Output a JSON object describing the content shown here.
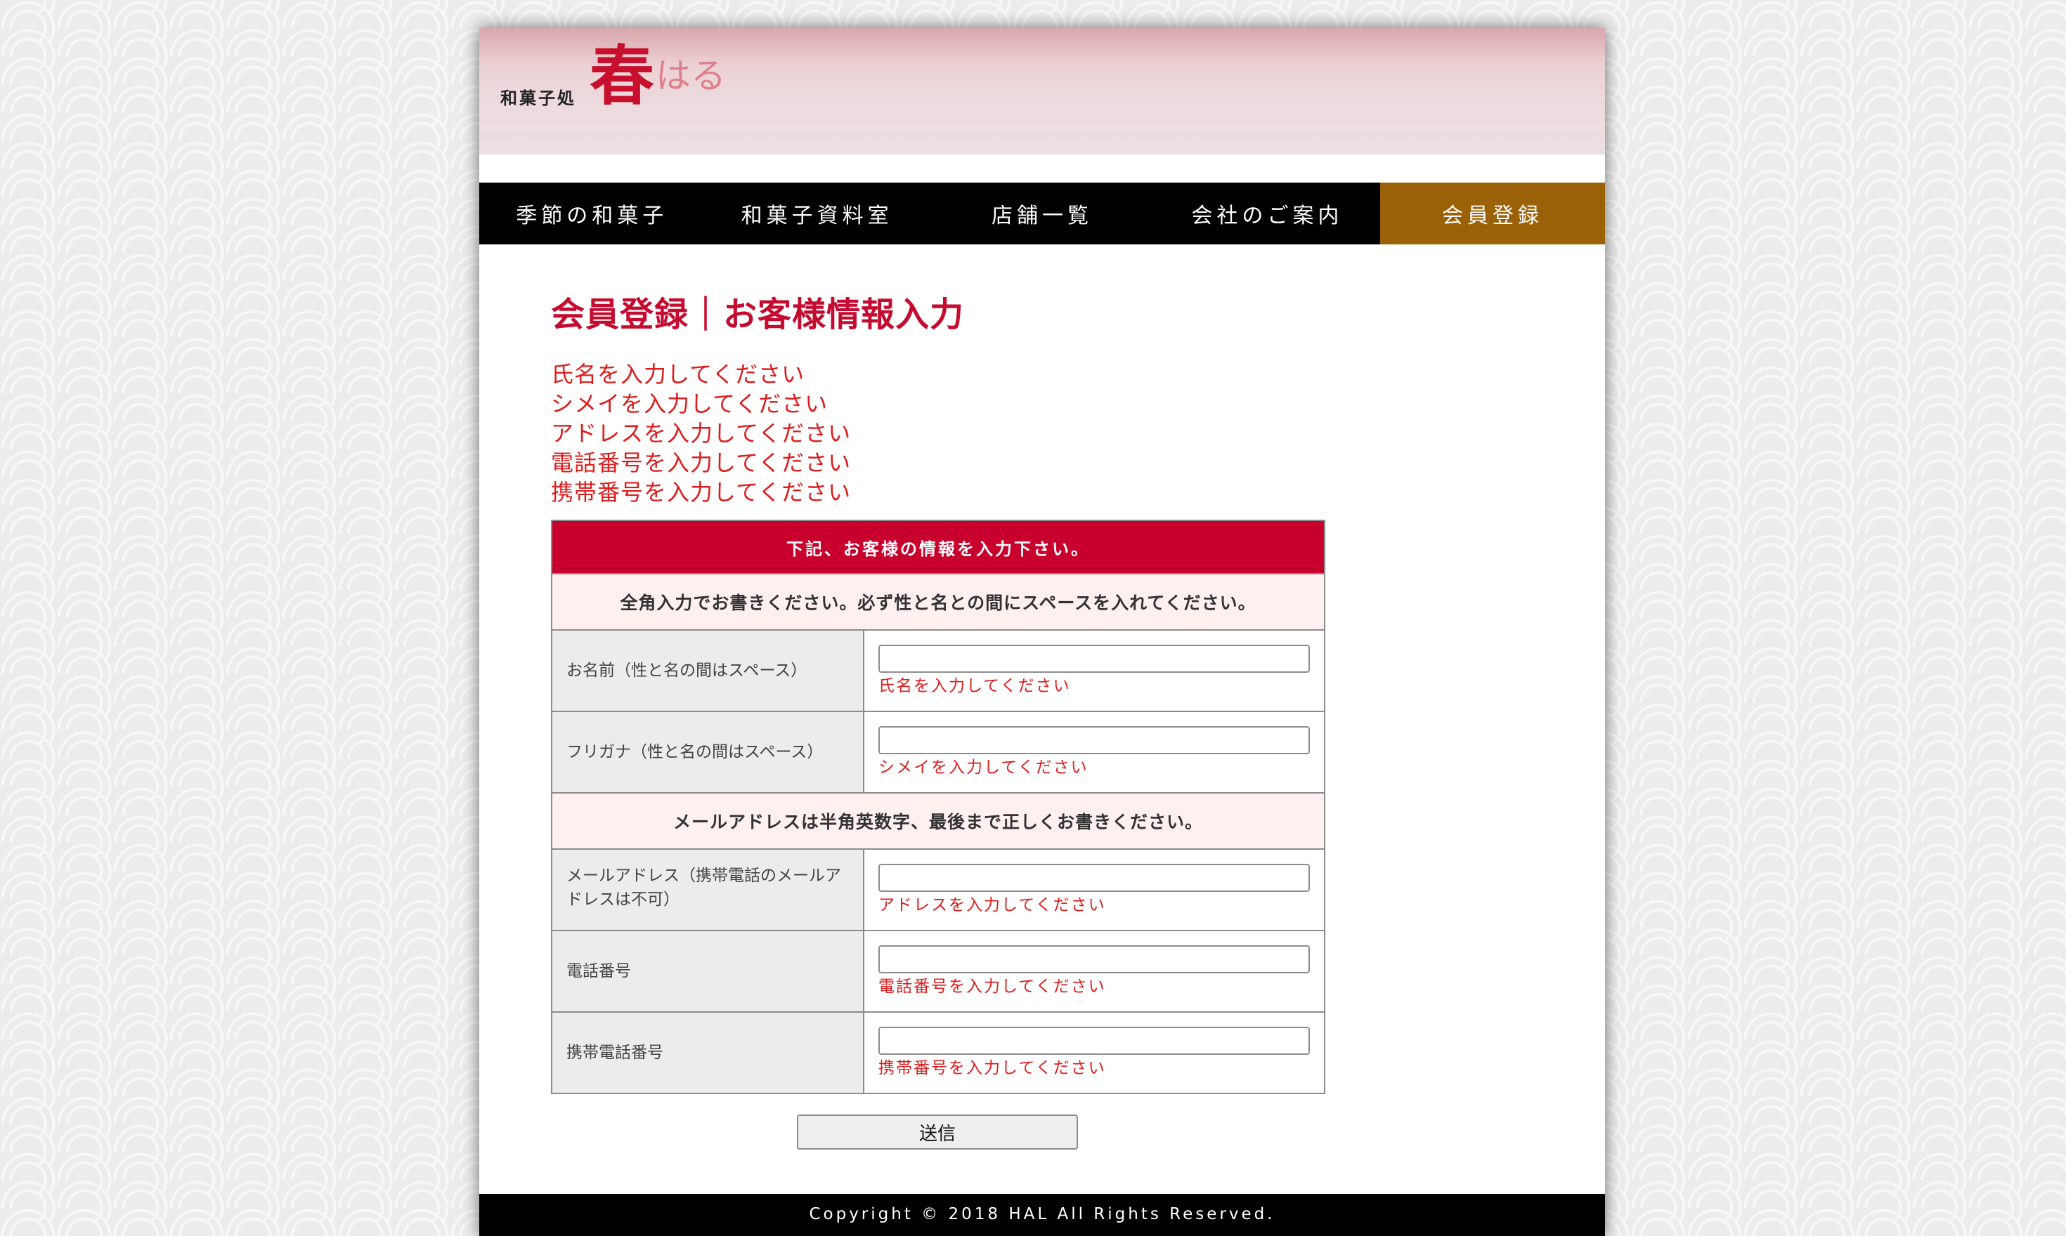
{
  "header": {
    "logo_sub": "和菓子処",
    "logo_kanji": "春",
    "logo_kana": "はる"
  },
  "nav": {
    "items": [
      "季節の和菓子",
      "和菓子資料室",
      "店舗一覧",
      "会社のご案内",
      "会員登録"
    ],
    "active_index": 4
  },
  "main": {
    "title": "会員登録｜お客様情報入力",
    "errors": [
      "氏名を入力してください",
      "シメイを入力してください",
      "アドレスを入力してください",
      "電話番号を入力してください",
      "携帯番号を入力してください"
    ]
  },
  "form": {
    "caption": "下記、お客様の情報を入力下さい。",
    "note1": "全角入力でお書きください。必ず性と名との間にスペースを入れてください。",
    "note2": "メールアドレスは半角英数字、最後まで正しくお書きください。",
    "fields": {
      "name": {
        "label": "お名前（性と名の間はスペース）",
        "value": "",
        "error": "氏名を入力してください"
      },
      "kana": {
        "label": "フリガナ（性と名の間はスペース）",
        "value": "",
        "error": "シメイを入力してください"
      },
      "email": {
        "label": "メールアドレス（携帯電話のメールアドレスは不可）",
        "value": "",
        "error": "アドレスを入力してください"
      },
      "phone": {
        "label": "電話番号",
        "value": "",
        "error": "電話番号を入力してください"
      },
      "mobile": {
        "label": "携帯電話番号",
        "value": "",
        "error": "携帯番号を入力してください"
      }
    },
    "submit_label": "送信"
  },
  "footer": {
    "copyright": "Copyright ©  2018 HAL All Rights Reserved."
  },
  "colors": {
    "brand_red": "#c8002d",
    "error_red": "#dd1d1d",
    "nav_active": "#9a6106",
    "note_bg": "#fff0f0"
  }
}
